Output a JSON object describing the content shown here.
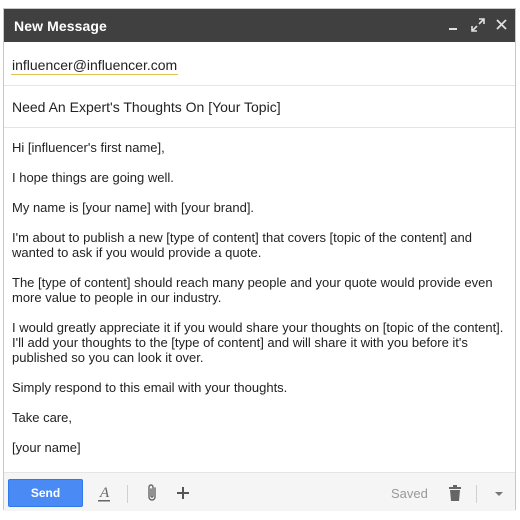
{
  "window": {
    "title": "New Message",
    "controls": [
      "minimize-icon",
      "expand-icon",
      "close-icon"
    ]
  },
  "recipient": "influencer@influencer.com",
  "subject": "Need An Expert's Thoughts On [Your Topic]",
  "body": {
    "paragraphs": [
      "Hi [influencer's first name],",
      "I hope things are going well.",
      "My name is [your name] with [your brand].",
      "I'm about to publish a new [type of content] that covers [topic of the content] and wanted to ask if you would provide a quote.",
      "The [type of content] should reach many people and your quote would provide even more value to people in our industry.",
      "I would greatly appreciate it if you would share your thoughts on [topic of the content]. I'll add your thoughts to the [type of content] and will share it with you before it's published so you can look it over.",
      "Simply respond to this email with your thoughts.",
      "Take care,",
      "[your name]"
    ]
  },
  "toolbar": {
    "send_label": "Send",
    "status": "Saved",
    "icons": [
      "formatting-icon",
      "attachment-icon",
      "insert-more-icon",
      "trash-icon",
      "more-options-icon"
    ]
  },
  "colors": {
    "titlebar": "#404040",
    "send_button": "#4a8af4",
    "recipient_underline": "#e0c050"
  }
}
